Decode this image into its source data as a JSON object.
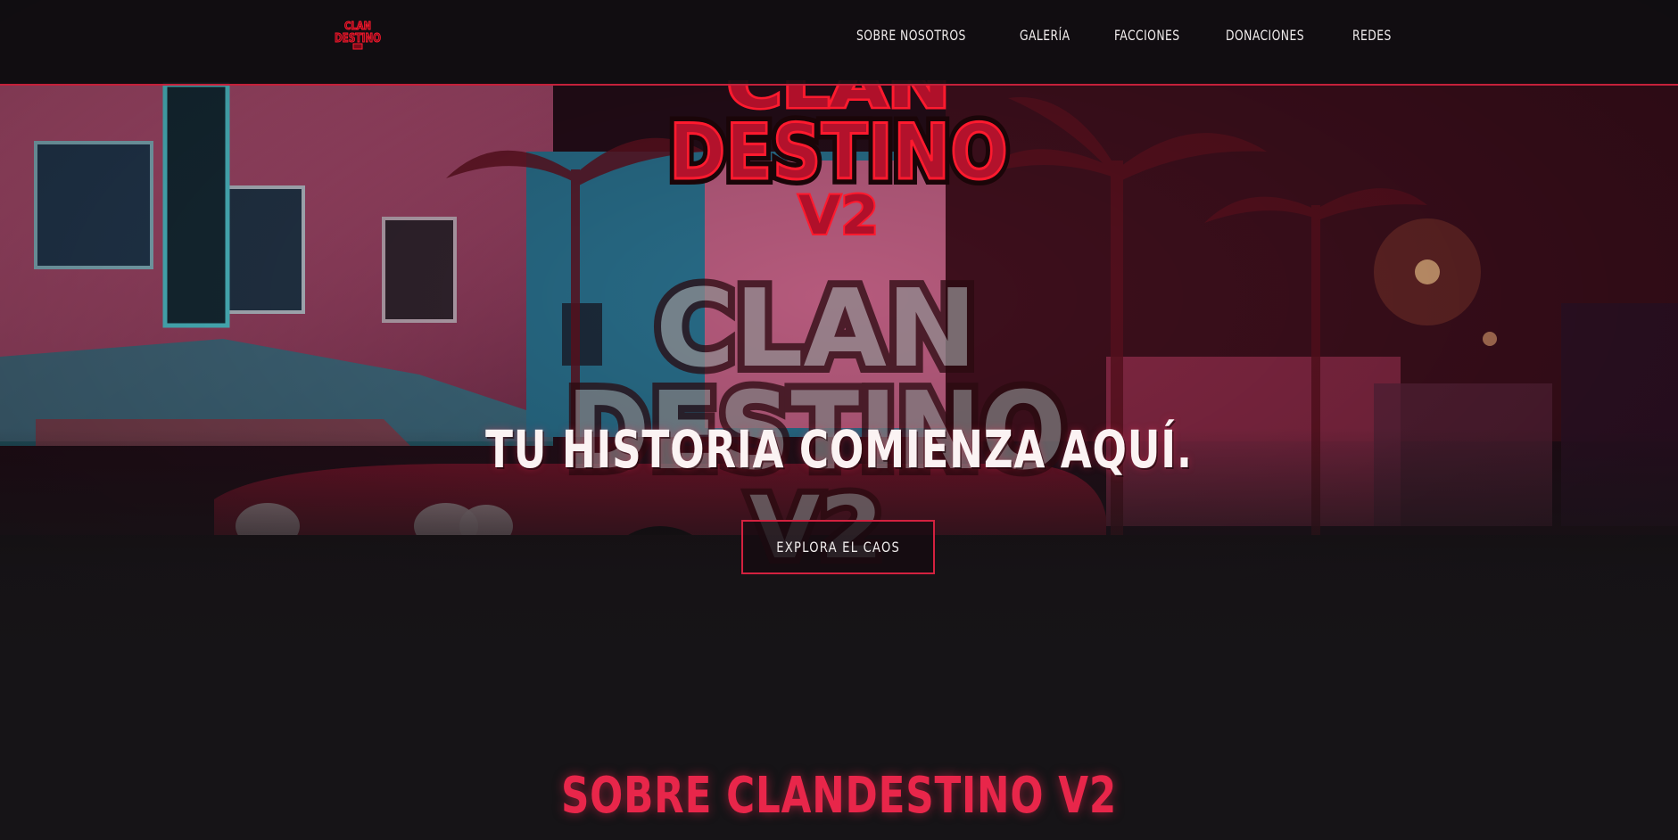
{
  "nav": {
    "logo_text_line1": "CLAN",
    "logo_text_line2": "DESTINO",
    "links": [
      {
        "label": "SOBRE NOSOTROS"
      },
      {
        "label": "GALERÍA"
      },
      {
        "label": "FACCIONES"
      },
      {
        "label": "DONACIONES"
      },
      {
        "label": "REDES"
      }
    ]
  },
  "hero": {
    "logo_line1": "CLAN",
    "logo_line2": "DESTINO",
    "logo_line3": "V2",
    "title": "TU HISTORIA COMIENZA AQUÍ.",
    "cta_label": "EXPLORA EL CAOS"
  },
  "about": {
    "title": "SOBRE CLANDESTINO V2"
  },
  "colors": {
    "accent": "#e8264a",
    "border_red": "#c4203a",
    "background": "#161417",
    "text": "#f1eded"
  },
  "icons": {
    "nav_logo": "clan-destino-logo-icon"
  }
}
